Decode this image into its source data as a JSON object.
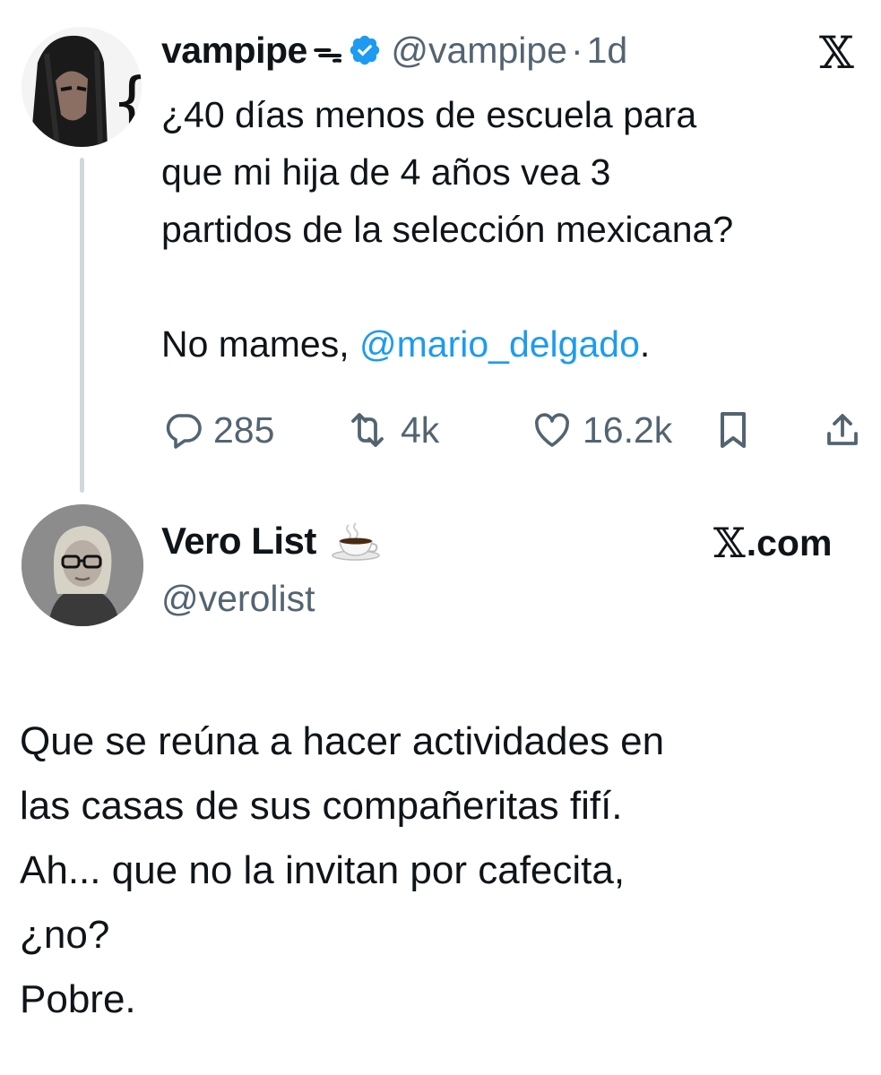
{
  "parent_tweet": {
    "author_name": "vampipe",
    "name_emoji": "ᯓ",
    "handle": "@vampipe",
    "separator": "·",
    "time": "1d",
    "platform_logo": "𝕏",
    "text_main": "¿40 días menos de escuela para\nque mi hija de 4 años vea 3\npartidos de la selección mexicana?\n\nNo mames, ",
    "mention": "@mario_delgado",
    "text_after_mention": ".",
    "stats": {
      "replies": "285",
      "retweets": "4k",
      "likes": "16.2k"
    },
    "icons": [
      "reply-icon",
      "retweet-icon",
      "like-icon",
      "bookmark-icon",
      "share-icon",
      "verified-badge-icon"
    ]
  },
  "reply": {
    "author_name": "Vero List",
    "name_emoji_icon": "coffee-cup-icon",
    "handle": "@verolist",
    "source_logo": "𝕏",
    "source_text": ".com",
    "text": "Que se reúna a hacer actividades en\nlas casas de sus compañeritas fifí.\nAh... que no la invitan por cafecita,\n¿no?\nPobre."
  },
  "colors": {
    "text": "#0f1419",
    "secondary": "#536471",
    "link": "#1d9bf0",
    "thread_line": "#cfd9de",
    "verified": "#1d9bf0"
  }
}
